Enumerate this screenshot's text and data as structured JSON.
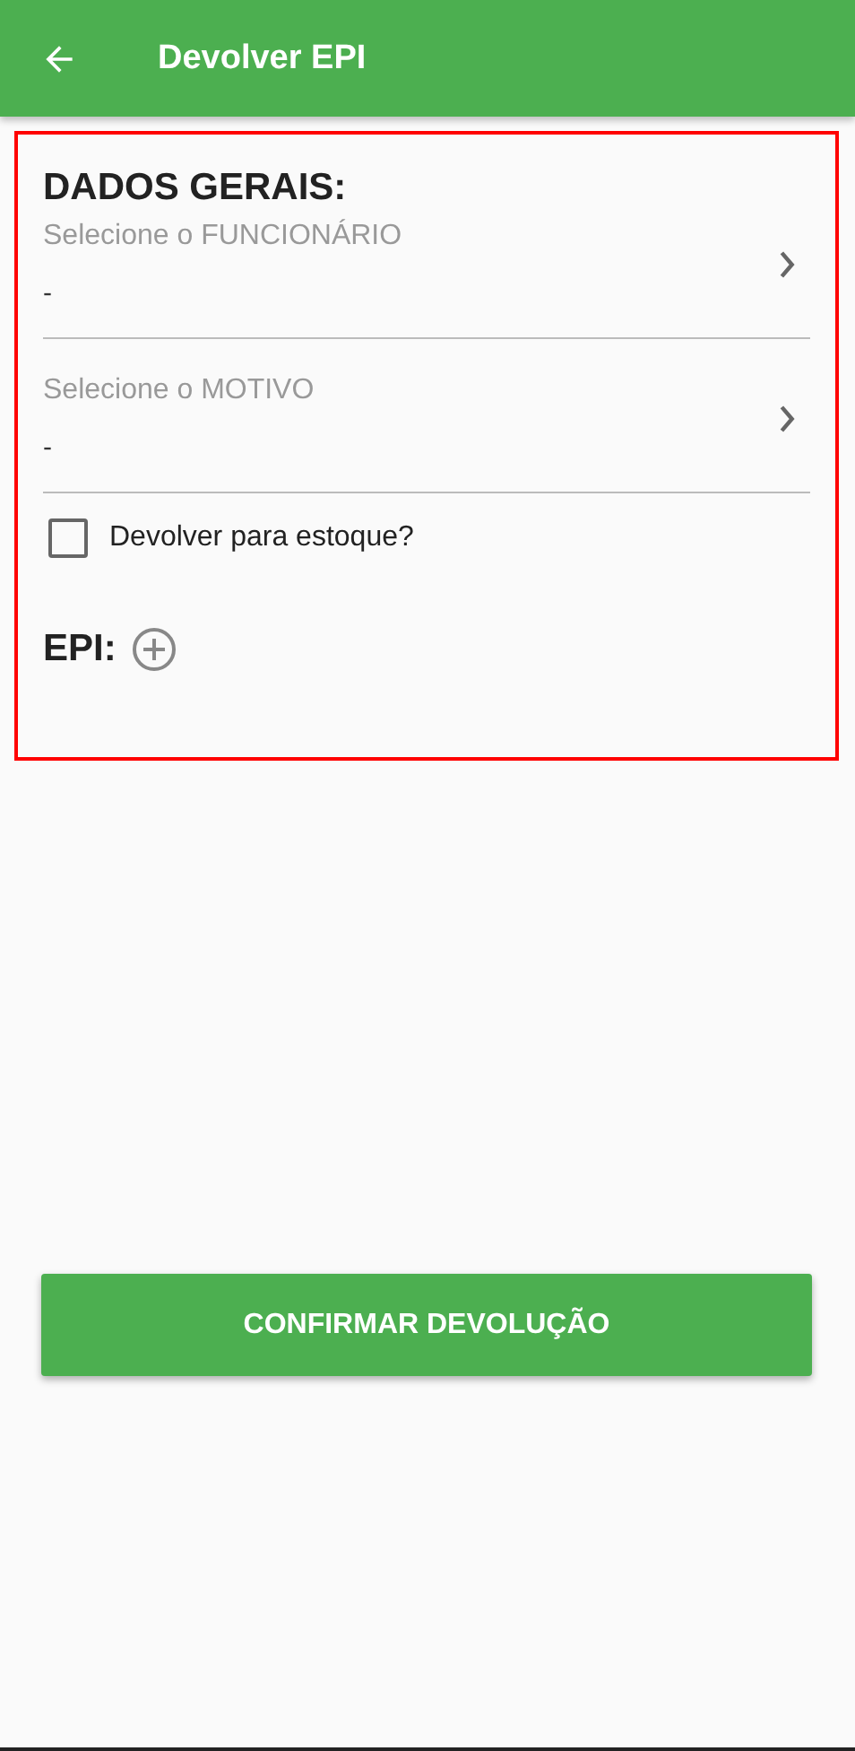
{
  "app_bar": {
    "title": "Devolver EPI"
  },
  "form": {
    "highlighted": true,
    "title": "DADOS GERAIS:",
    "pickers": [
      {
        "label": "Selecione o FUNCIONÁRIO",
        "value": "-"
      },
      {
        "label": "Selecione o MOTIVO",
        "value": "-"
      }
    ],
    "checkbox": {
      "label": "Devolver para estoque?",
      "checked": false
    },
    "epi_label": "EPI:"
  },
  "confirm_button": "CONFIRMAR DEVOLUÇÃO"
}
